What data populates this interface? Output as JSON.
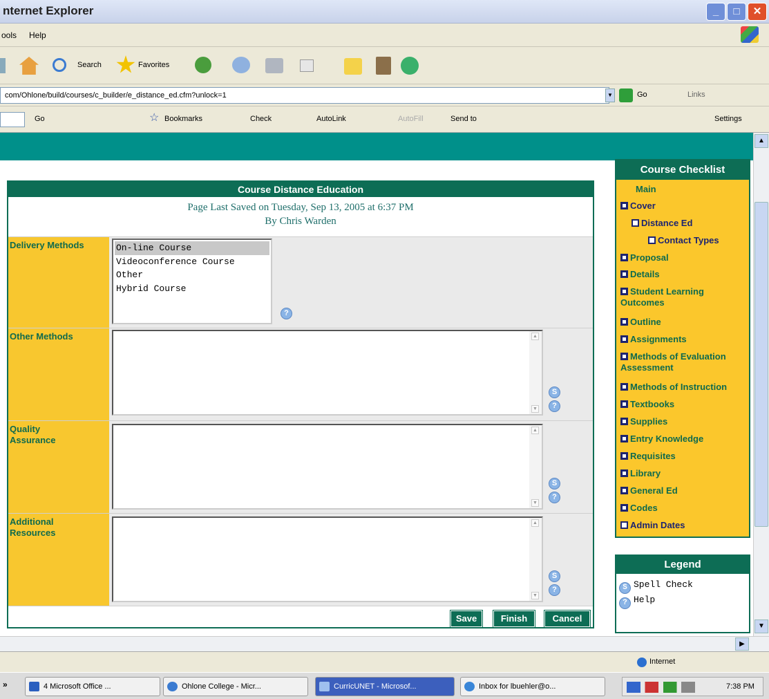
{
  "window": {
    "title": "nternet Explorer"
  },
  "menu": {
    "items": [
      "ools",
      "Help"
    ]
  },
  "toolbar": {
    "search": "Search",
    "favorites": "Favorites"
  },
  "address": {
    "url": "com/Ohlone/build/courses/c_builder/e_distance_ed.cfm?unlock=1",
    "go": "Go",
    "links": "Links"
  },
  "google_bar": {
    "go": "Go",
    "bookmarks": "Bookmarks",
    "check": "Check",
    "autolink": "AutoLink",
    "autofill": "AutoFill",
    "sendto": "Send to",
    "settings": "Settings"
  },
  "form": {
    "title": "Course Distance Education",
    "saved_line1": "Page Last Saved on Tuesday, Sep 13, 2005 at 6:37 PM",
    "saved_line2": "By Chris Warden",
    "delivery": {
      "label": "Delivery Methods",
      "options": [
        "On-line Course",
        "Videoconference Course",
        "Other",
        "Hybrid Course"
      ],
      "selected": "On-line Course"
    },
    "other_methods": {
      "label": "Other Methods",
      "value": ""
    },
    "quality_assurance": {
      "label": "Quality Assurance",
      "value": ""
    },
    "additional_resources": {
      "label": "Additional Resources",
      "value": ""
    },
    "buttons": {
      "save": "Save",
      "finish": "Finish",
      "cancel": "Cancel"
    }
  },
  "checklist": {
    "title": "Course Checklist",
    "items": [
      {
        "label": "Main",
        "icon": "none",
        "complete": null
      },
      {
        "label": "Cover",
        "icon": "checkbox",
        "complete": true
      },
      {
        "label": "Distance Ed",
        "icon": "checkbox",
        "complete": false
      },
      {
        "label": "Contact Types",
        "icon": "checkbox",
        "complete": false
      },
      {
        "label": "Proposal",
        "icon": "checkbox",
        "complete": true
      },
      {
        "label": "Details",
        "icon": "checkbox",
        "complete": true
      },
      {
        "label": "Student Learning Outcomes",
        "icon": "checkbox",
        "complete": true
      },
      {
        "label": "Outline",
        "icon": "checkbox",
        "complete": true
      },
      {
        "label": "Assignments",
        "icon": "checkbox",
        "complete": true
      },
      {
        "label": "Methods of Evaluation Assessment",
        "icon": "checkbox",
        "complete": true
      },
      {
        "label": "Methods of Instruction",
        "icon": "checkbox",
        "complete": true
      },
      {
        "label": "Textbooks",
        "icon": "checkbox",
        "complete": true
      },
      {
        "label": "Supplies",
        "icon": "checkbox",
        "complete": true
      },
      {
        "label": "Entry Knowledge",
        "icon": "checkbox",
        "complete": true
      },
      {
        "label": "Requisites",
        "icon": "checkbox",
        "complete": true
      },
      {
        "label": "Library",
        "icon": "checkbox",
        "complete": true
      },
      {
        "label": "General Ed",
        "icon": "checkbox",
        "complete": true
      },
      {
        "label": "Codes",
        "icon": "checkbox",
        "complete": true
      },
      {
        "label": "Admin Dates",
        "icon": "checkbox",
        "complete": false
      }
    ]
  },
  "legend": {
    "title": "Legend",
    "spell": "Spell Check",
    "help": "Help"
  },
  "status": {
    "zone": "Internet"
  },
  "taskbar": {
    "buttons": [
      {
        "label": "4 Microsoft Office ...",
        "active": false
      },
      {
        "label": "Ohlone College - Micr...",
        "active": false
      },
      {
        "label": "CurricUNET - Microsof...",
        "active": true
      },
      {
        "label": "Inbox for lbuehler@o...",
        "active": false
      }
    ],
    "clock": "7:38 PM"
  },
  "colors": {
    "teal": "#00908a",
    "form_green": "#0d6d55",
    "label_yellow": "#f8c72f",
    "link_green": "#0f6a4d",
    "checkbox_navy": "#1d2470"
  }
}
